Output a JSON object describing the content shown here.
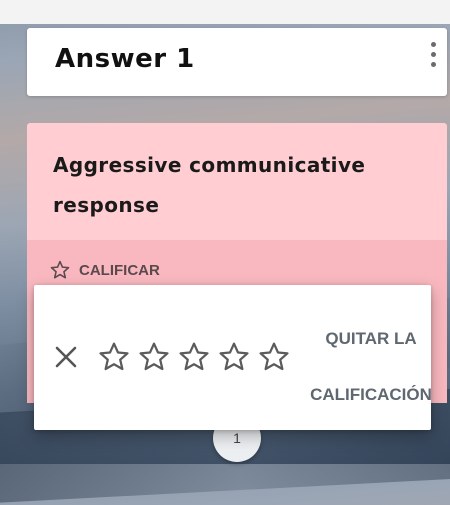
{
  "title_card": {
    "title": "Answer 1",
    "menu_icon": "more-vert-icon"
  },
  "answer_card": {
    "text": "Aggressive communicative response",
    "rate_icon": "star-outline-icon",
    "rate_label": "CALIFICAR",
    "background_color": "#ffcdd2"
  },
  "rating_popup": {
    "close_icon": "close-icon",
    "stars": [
      {
        "icon": "star-outline-icon"
      },
      {
        "icon": "star-outline-icon"
      },
      {
        "icon": "star-outline-icon"
      },
      {
        "icon": "star-outline-icon"
      },
      {
        "icon": "star-outline-icon"
      }
    ],
    "rating": 0,
    "max_rating": 5,
    "clear_label": "QUITAR LA\nCALIFICACIÓN"
  },
  "bottom_button": {
    "label": "1"
  }
}
